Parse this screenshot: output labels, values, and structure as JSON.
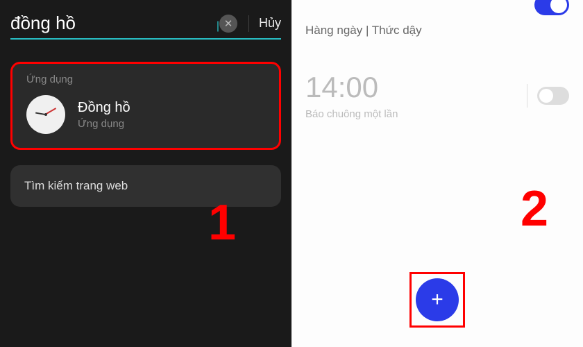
{
  "left": {
    "search_value": "đồng hồ",
    "cancel_label": "Hủy",
    "section_label": "Ứng dụng",
    "app_name": "Đồng hồ",
    "app_sub": "Ứng dụng",
    "web_search": "Tìm kiếm trang web",
    "step": "1"
  },
  "right": {
    "alarm1_desc": "Hàng ngày | Thức dậy",
    "alarm2_time": "14:00",
    "alarm2_desc": "Báo chuông một lần",
    "step": "2"
  }
}
